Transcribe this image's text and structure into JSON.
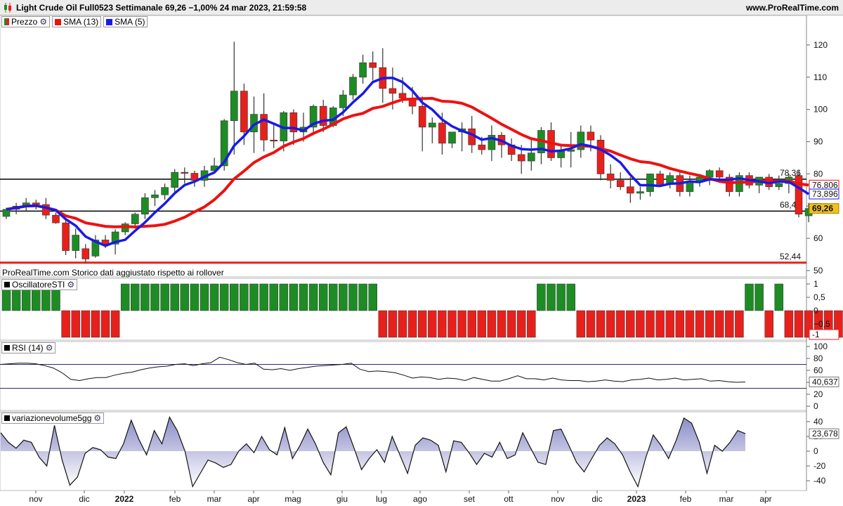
{
  "header": {
    "title": "Light Crude Oil Full0523 Settimanale 69,26 −1,00% 24 mar 2023, 21:59:58",
    "site": "www.ProRealTime.com"
  },
  "colors": {
    "up": "#1e8c24",
    "down": "#e8201c",
    "sma13": "#ee1111",
    "sma5": "#1a1ae6",
    "rsiLine": "#1a1a7a",
    "volFill": "#c8c8e6"
  },
  "legend": {
    "price": {
      "icon": "candle-icon",
      "label": "Prezzo"
    },
    "sma13": {
      "label": "SMA (13)"
    },
    "sma5": {
      "label": "SMA (5)"
    }
  },
  "chart_data": [
    {
      "type": "candlestick",
      "ylim": [
        50,
        125
      ],
      "yticks": [
        50,
        60,
        70,
        80,
        90,
        100,
        110,
        120
      ],
      "xticks": [
        "nov",
        "dic",
        "2022",
        "feb",
        "mar",
        "apr",
        "mag",
        "giu",
        "lug",
        "ago",
        "set",
        "ott",
        "nov",
        "dic",
        "2023",
        "feb",
        "mar",
        "apr"
      ],
      "bold_ticks": [
        "2022",
        "2023"
      ],
      "watermark": "ProRealTime.com  Storico dati aggiustato rispetto ai rollover",
      "hlines": [
        {
          "value": 78.36,
          "label": "78,36",
          "color": "#000000"
        },
        {
          "value": 68.46,
          "label": "68,46",
          "color": "#000000"
        },
        {
          "value": 52.44,
          "label": "52,44",
          "color": "#e8201c"
        }
      ],
      "last_labels": {
        "sma13": "76,806",
        "sma5": "73,896",
        "price": "69,26"
      },
      "candles": [
        [
          66.8,
          69.5,
          66.0,
          69.0
        ],
        [
          69.0,
          71.0,
          67.5,
          70.0
        ],
        [
          70.0,
          72.5,
          68.5,
          71.0
        ],
        [
          71.0,
          72.0,
          69.0,
          70.5
        ],
        [
          70.5,
          72.5,
          66.0,
          67.2
        ],
        [
          67.2,
          68.0,
          64.5,
          64.8
        ],
        [
          64.8,
          66.0,
          54.8,
          56.2
        ],
        [
          56.2,
          63.0,
          53.8,
          61.0
        ],
        [
          56.8,
          58.2,
          52.5,
          53.6
        ],
        [
          54.5,
          61.0,
          54.0,
          59.5
        ],
        [
          59.5,
          61.0,
          57.0,
          58.2
        ],
        [
          58.2,
          62.8,
          55.0,
          62.0
        ],
        [
          62.0,
          65.0,
          61.0,
          64.5
        ],
        [
          64.5,
          68.0,
          63.0,
          67.5
        ],
        [
          67.5,
          74.0,
          66.0,
          72.6
        ],
        [
          72.6,
          75.0,
          70.0,
          73.5
        ],
        [
          73.5,
          77.0,
          72.0,
          75.8
        ],
        [
          75.8,
          81.5,
          74.0,
          80.5
        ],
        [
          80.5,
          82.0,
          77.0,
          80.2
        ],
        [
          80.2,
          81.0,
          76.0,
          78.0
        ],
        [
          78.0,
          82.5,
          76.0,
          81.0
        ],
        [
          81.0,
          85.0,
          80.0,
          82.5
        ],
        [
          82.5,
          97.0,
          81.0,
          96.5
        ],
        [
          96.5,
          121.0,
          86.0,
          105.7
        ],
        [
          105.7,
          108.0,
          89.0,
          93.0
        ],
        [
          93.0,
          104.0,
          86.5,
          98.5
        ],
        [
          98.5,
          105.0,
          87.0,
          90.5
        ],
        [
          90.5,
          96.0,
          88.0,
          90.2
        ],
        [
          90.2,
          99.5,
          87.0,
          99.0
        ],
        [
          99.0,
          100.0,
          89.0,
          93.0
        ],
        [
          93.0,
          99.0,
          90.0,
          94.5
        ],
        [
          94.5,
          101.5,
          92.0,
          101.0
        ],
        [
          101.0,
          103.0,
          93.0,
          95.0
        ],
        [
          95.0,
          101.0,
          94.5,
          100.5
        ],
        [
          100.5,
          106.0,
          98.0,
          104.5
        ],
        [
          104.5,
          111.0,
          103.0,
          110.0
        ],
        [
          110.0,
          117.0,
          108.0,
          114.5
        ],
        [
          114.5,
          118.0,
          109.0,
          113.0
        ],
        [
          113.0,
          119.0,
          102.0,
          106.5
        ],
        [
          106.5,
          113.0,
          100.0,
          105.0
        ],
        [
          105.0,
          110.0,
          102.0,
          103.5
        ],
        [
          103.5,
          107.0,
          98.5,
          101.0
        ],
        [
          101.0,
          104.0,
          87.0,
          94.5
        ],
        [
          94.5,
          97.5,
          89.5,
          95.8
        ],
        [
          95.8,
          99.0,
          86.0,
          89.5
        ],
        [
          89.5,
          93.0,
          88.0,
          93.0
        ],
        [
          93.0,
          96.0,
          87.0,
          94.0
        ],
        [
          94.0,
          98.0,
          86.5,
          89.0
        ],
        [
          89.0,
          91.5,
          86.0,
          87.5
        ],
        [
          87.5,
          95.0,
          84.0,
          92.0
        ],
        [
          92.0,
          93.0,
          85.0,
          89.0
        ],
        [
          89.0,
          91.0,
          84.0,
          86.0
        ],
        [
          86.0,
          89.0,
          80.0,
          84.0
        ],
        [
          84.0,
          91.0,
          81.0,
          86.5
        ],
        [
          86.5,
          94.5,
          83.0,
          93.5
        ],
        [
          93.5,
          96.0,
          84.0,
          85.0
        ],
        [
          85.0,
          89.0,
          82.0,
          87.0
        ],
        [
          87.0,
          93.0,
          82.0,
          87.5
        ],
        [
          87.5,
          95.0,
          85.0,
          93.0
        ],
        [
          93.0,
          95.0,
          87.0,
          90.5
        ],
        [
          90.5,
          92.0,
          78.0,
          80.0
        ],
        [
          80.0,
          83.0,
          75.5,
          78.0
        ],
        [
          78.0,
          80.5,
          75.0,
          76.0
        ],
        [
          76.0,
          79.0,
          71.0,
          74.0
        ],
        [
          74.0,
          76.0,
          72.0,
          74.5
        ],
        [
          74.5,
          80.0,
          73.0,
          80.0
        ],
        [
          80.0,
          81.0,
          76.0,
          76.8
        ],
        [
          76.8,
          80.5,
          75.5,
          79.5
        ],
        [
          79.5,
          81.0,
          73.0,
          74.5
        ],
        [
          74.5,
          79.5,
          73.0,
          77.5
        ],
        [
          77.5,
          80.0,
          76.0,
          79.0
        ],
        [
          79.0,
          81.5,
          76.5,
          81.0
        ],
        [
          81.0,
          82.0,
          78.0,
          79.0
        ],
        [
          79.0,
          80.0,
          73.0,
          74.5
        ],
        [
          74.5,
          80.5,
          73.0,
          79.5
        ],
        [
          79.5,
          80.5,
          75.5,
          76.5
        ],
        [
          76.5,
          79.0,
          74.0,
          79.0
        ],
        [
          79.0,
          80.0,
          75.0,
          76.0
        ],
        [
          76.0,
          79.5,
          75.0,
          77.0
        ],
        [
          77.0,
          80.0,
          74.0,
          79.0
        ],
        [
          79.5,
          81.0,
          66.5,
          67.5
        ],
        [
          67.0,
          71.0,
          65.0,
          69.26
        ]
      ],
      "sma5_last": 73.896,
      "sma13_last": 76.806
    },
    {
      "type": "bar",
      "name": "OscillatoreSTI",
      "ylim": [
        -1,
        1
      ],
      "yticks": [
        "1",
        "0,5",
        "0",
        "−0,5"
      ],
      "last_label": "-1",
      "values": [
        1,
        1,
        1,
        1,
        1,
        1,
        -1,
        -1,
        -1,
        -1,
        -1,
        -1,
        1,
        1,
        1,
        1,
        1,
        1,
        1,
        1,
        1,
        1,
        1,
        1,
        1,
        1,
        1,
        1,
        1,
        1,
        1,
        1,
        1,
        1,
        1,
        1,
        1,
        1,
        -1,
        -1,
        -1,
        -1,
        -1,
        -1,
        -1,
        -1,
        -1,
        -1,
        -1,
        -1,
        -1,
        -1,
        -1,
        -1,
        1,
        1,
        1,
        1,
        -1,
        -1,
        -1,
        -1,
        -1,
        -1,
        -1,
        -1,
        -1,
        -1,
        -1,
        -1,
        -1,
        -1,
        -1,
        -1,
        -1,
        1,
        1,
        -1,
        1,
        -1,
        -1,
        -1,
        -1,
        -1,
        -1,
        -1
      ]
    },
    {
      "type": "line",
      "name": "RSI (14)",
      "ylim": [
        0,
        100
      ],
      "yticks": [
        100,
        80,
        60,
        40,
        20,
        0
      ],
      "hlines": [
        70,
        30
      ],
      "last_label": "40,637",
      "values": [
        70,
        71,
        72,
        72,
        71,
        68,
        64,
        56,
        45,
        43,
        46,
        48,
        48,
        52,
        55,
        57,
        61,
        64,
        66,
        67,
        70,
        71,
        68,
        71,
        73,
        82,
        78,
        73,
        70,
        72,
        62,
        61,
        63,
        60,
        63,
        65,
        67,
        68,
        69,
        70,
        72,
        62,
        58,
        59,
        58,
        56,
        52,
        47,
        49,
        48,
        45,
        47,
        46,
        43,
        48,
        45,
        42,
        42,
        46,
        51,
        46,
        46,
        44,
        47,
        44,
        43,
        43,
        41,
        42,
        44,
        42,
        41,
        44,
        45,
        47,
        44,
        45,
        47,
        44,
        45,
        46,
        42,
        43,
        41,
        40,
        40.637
      ]
    },
    {
      "type": "area",
      "name": "variazionevolume5gg",
      "ylim": [
        -50,
        50
      ],
      "yticks": [
        40,
        20,
        0,
        -20,
        -40
      ],
      "last_label": "23,678",
      "values": [
        25,
        12,
        4,
        15,
        12,
        -8,
        -20,
        35,
        -12,
        -46,
        -35,
        -3,
        5,
        2,
        -8,
        -10,
        10,
        42,
        16,
        -5,
        28,
        10,
        46,
        28,
        0,
        -48,
        -30,
        -12,
        -16,
        -22,
        -18,
        0,
        10,
        -2,
        20,
        2,
        -5,
        32,
        -10,
        8,
        30,
        10,
        -15,
        -32,
        25,
        33,
        5,
        -25,
        -10,
        2,
        -15,
        20,
        -5,
        -30,
        8,
        18,
        15,
        8,
        -28,
        14,
        12,
        -2,
        -18,
        -3,
        -8,
        12,
        -10,
        -5,
        25,
        5,
        -15,
        -18,
        28,
        30,
        8,
        -15,
        -28,
        -10,
        8,
        18,
        10,
        -5,
        -28,
        -48,
        -10,
        22,
        8,
        -10,
        15,
        45,
        38,
        12,
        -30,
        8,
        0,
        12,
        28,
        23.678
      ]
    }
  ],
  "osc_panel": {
    "label": "OscillatoreSTI"
  },
  "rsi_panel": {
    "label": "RSI (14)"
  },
  "vol_panel": {
    "label": "variazionevolume5gg"
  }
}
